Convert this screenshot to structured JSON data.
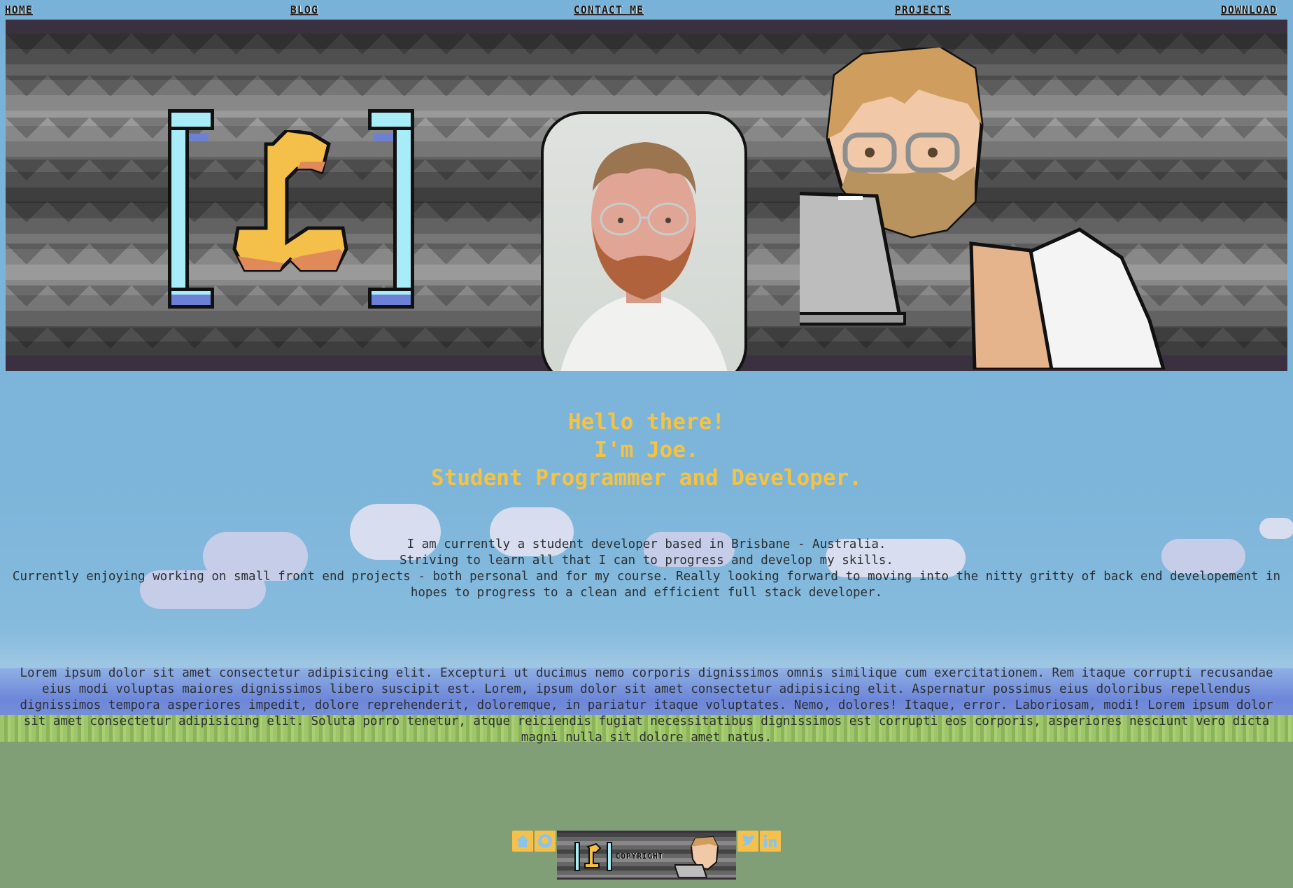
{
  "nav": {
    "items": [
      "HOME",
      "BLOG",
      "CONTACT ME",
      "PROJECTS",
      "DOWNLOAD"
    ]
  },
  "hero": {
    "line1": "Hello there!",
    "line2": "I'm Joe.",
    "line3": "Student Programmer and Developer."
  },
  "about": {
    "line1": "I am currently a student developer based in Brisbane - Australia.",
    "line2": "Striving to learn all that I can to progress and develop my skills.",
    "line3": "Currently enjoying working on small front end projects - both personal and for my course. Really looking forward to moving into the nitty gritty of back end developement in hopes to progress to a clean and efficient full stack developer."
  },
  "lorem": "Lorem ipsum dolor sit amet consectetur adipisicing elit. Excepturi ut ducimus nemo corporis dignissimos omnis similique cum exercitationem. Rem itaque corrupti recusandae eius modi voluptas maiores dignissimos libero suscipit est. Lorem, ipsum dolor sit amet consectetur adipisicing elit. Aspernatur possimus eius doloribus repellendus dignissimos tempora asperiores impedit, dolore reprehenderit, doloremque, in pariatur itaque voluptates. Nemo, dolores! Itaque, error. Laboriosam, modi! Lorem ipsum dolor sit amet consectetur adipisicing elit. Soluta porro tenetur, atque reiciendis fugiat necessitatibus dignissimos est corrupti eos corporis, asperiores nesciunt vero dicta magni nulla sit dolore amet natus.",
  "footer": {
    "copyright": "COPYRIGHT",
    "icons": [
      "home-icon",
      "github-icon",
      "twitter-icon",
      "linkedin-icon"
    ]
  },
  "colors": {
    "accent": "#f5c342",
    "sky": "#7ab3d8",
    "ground": "#819f77",
    "bracket": "#a7ecf7"
  }
}
